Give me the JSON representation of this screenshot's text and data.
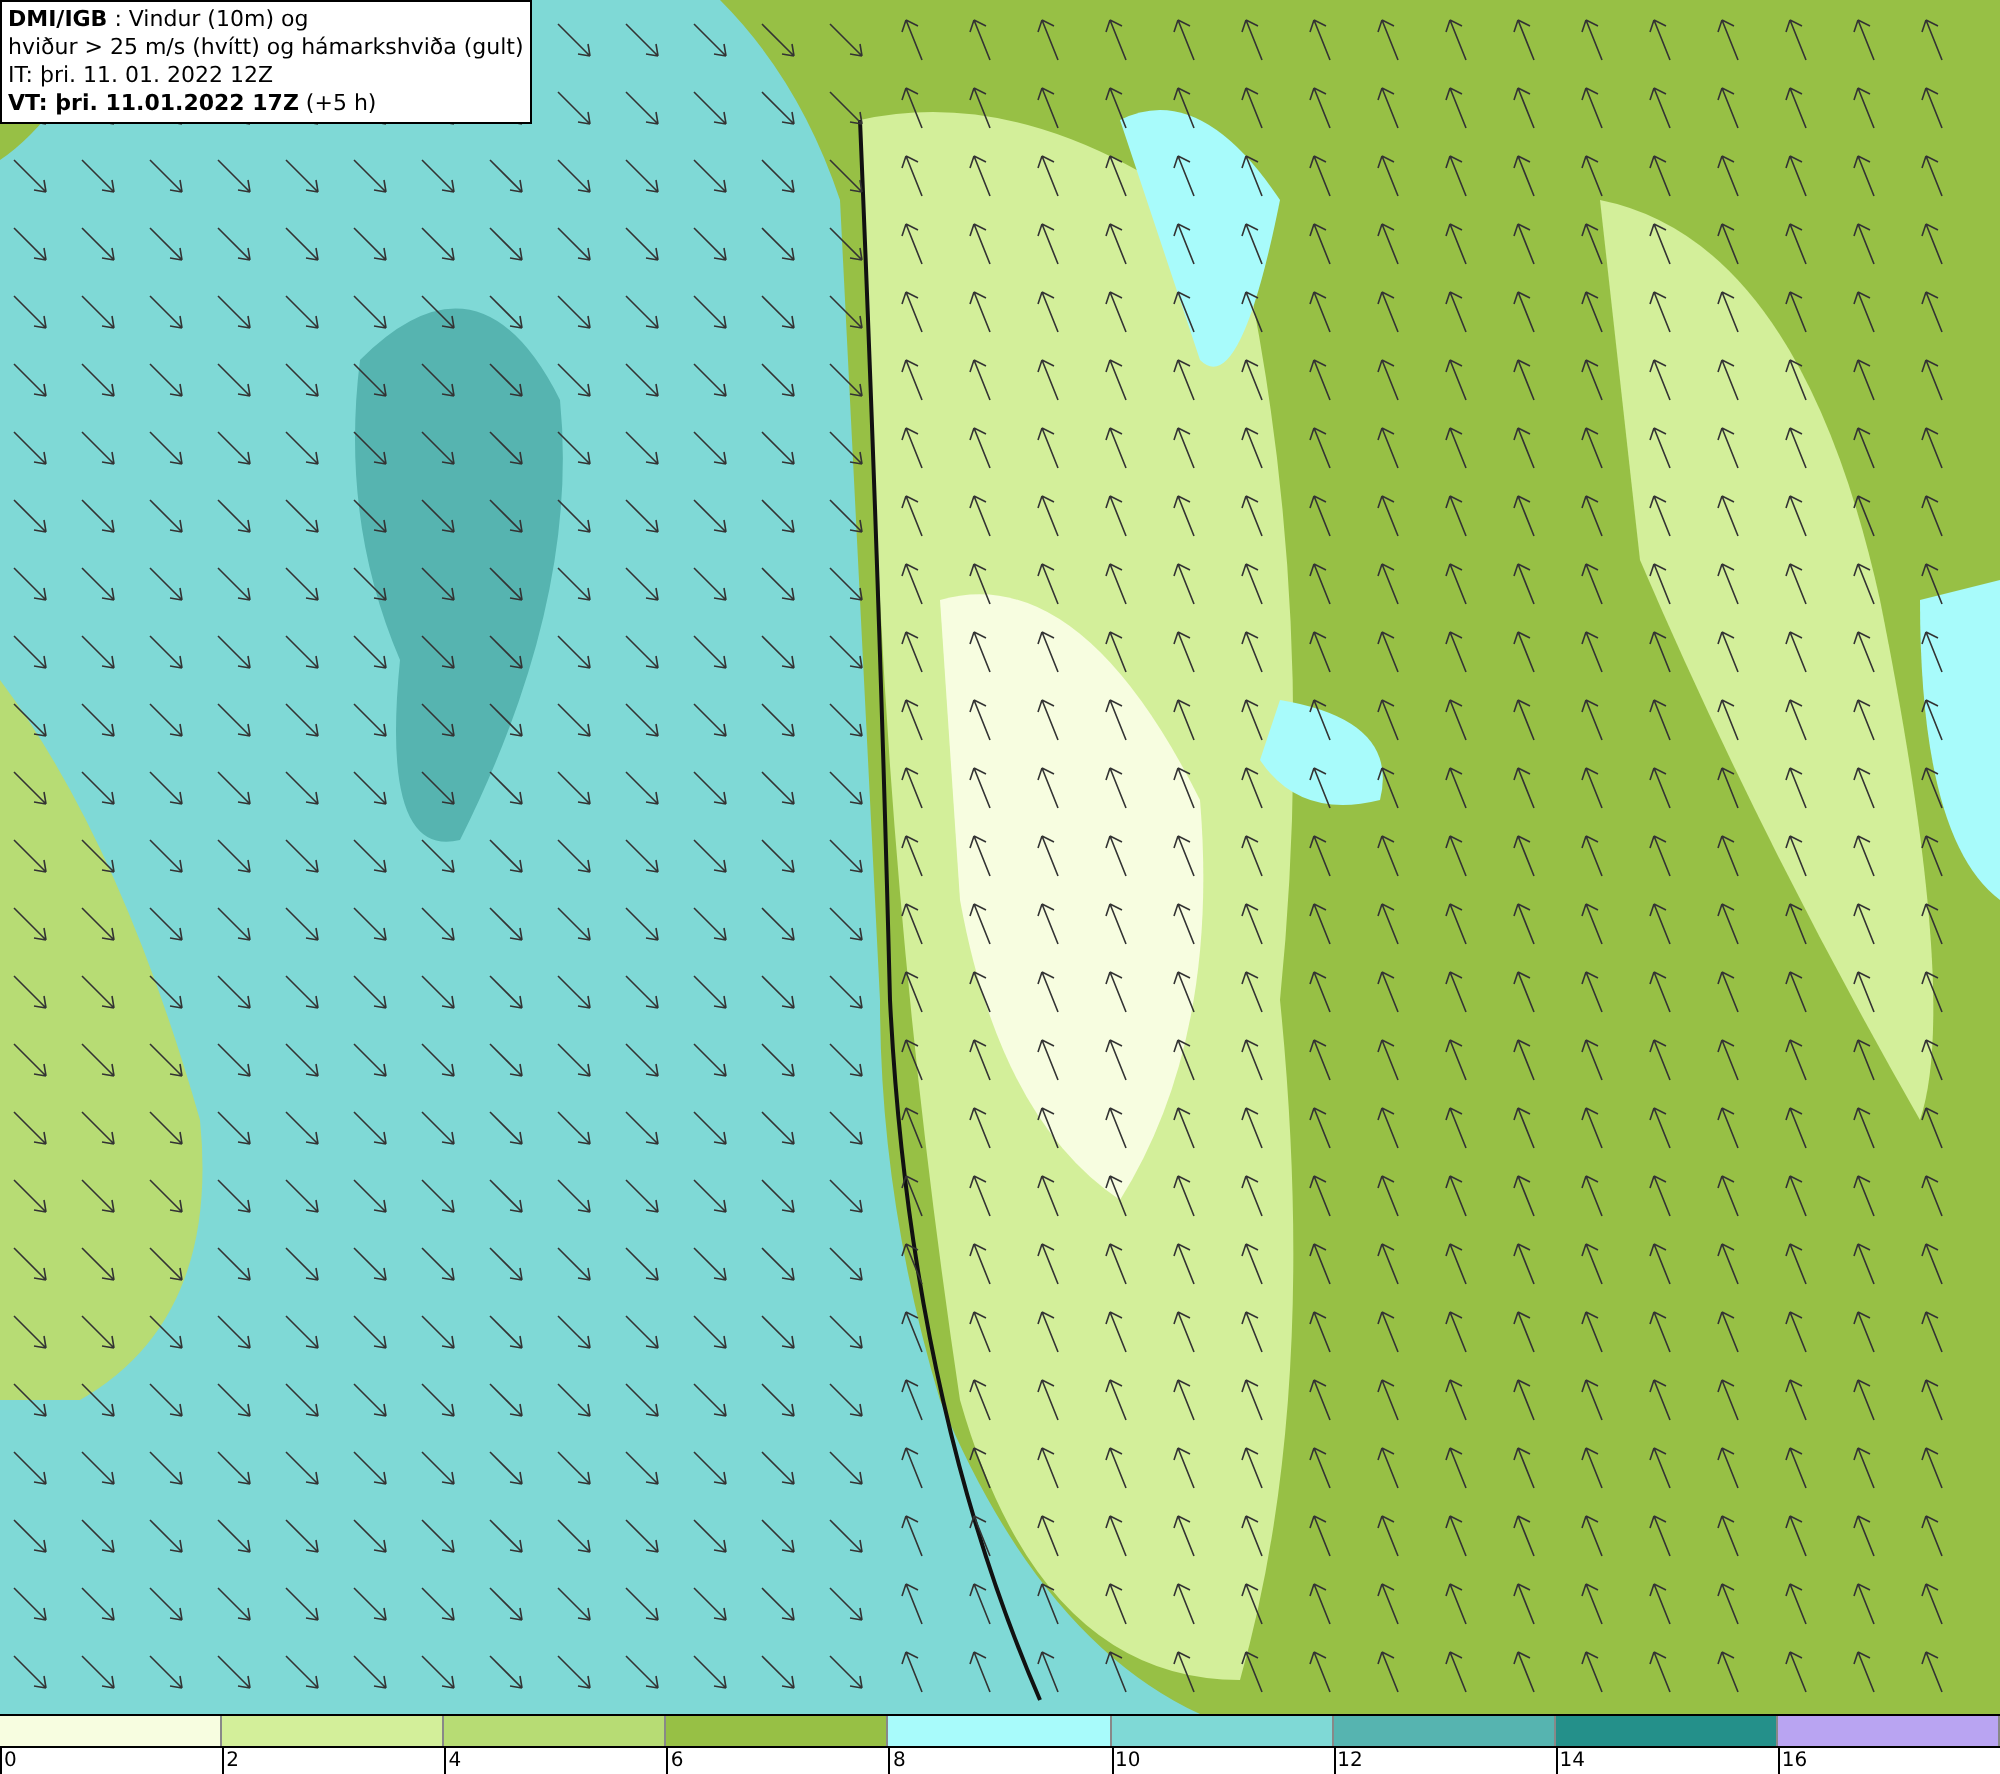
{
  "info_box": {
    "lines": [
      "**DMI/IGB** : Vindur (10m) og",
      "hviður > 25 m/s (hvítt) og hámarkshviða (gult)",
      "IT: þri. 11. 01. 2022 12Z",
      "**VT: þri. 11.01.2022 17Z** (+5 h)"
    ]
  },
  "legend": {
    "segments": [
      {
        "color": "#f7fde0",
        "label": "0"
      },
      {
        "color": "#d3ef9a",
        "label": "2"
      },
      {
        "color": "#b7dc74",
        "label": "4"
      },
      {
        "color": "#97c045",
        "label": "6"
      },
      {
        "color": "#a8fbfb",
        "label": "8"
      },
      {
        "color": "#7fd9d6",
        "label": "10"
      },
      {
        "color": "#56b4b0",
        "label": "12"
      },
      {
        "color": "#24908a",
        "label": "14"
      },
      {
        "color": "#b9a4f2",
        "label": "16"
      }
    ]
  }
}
